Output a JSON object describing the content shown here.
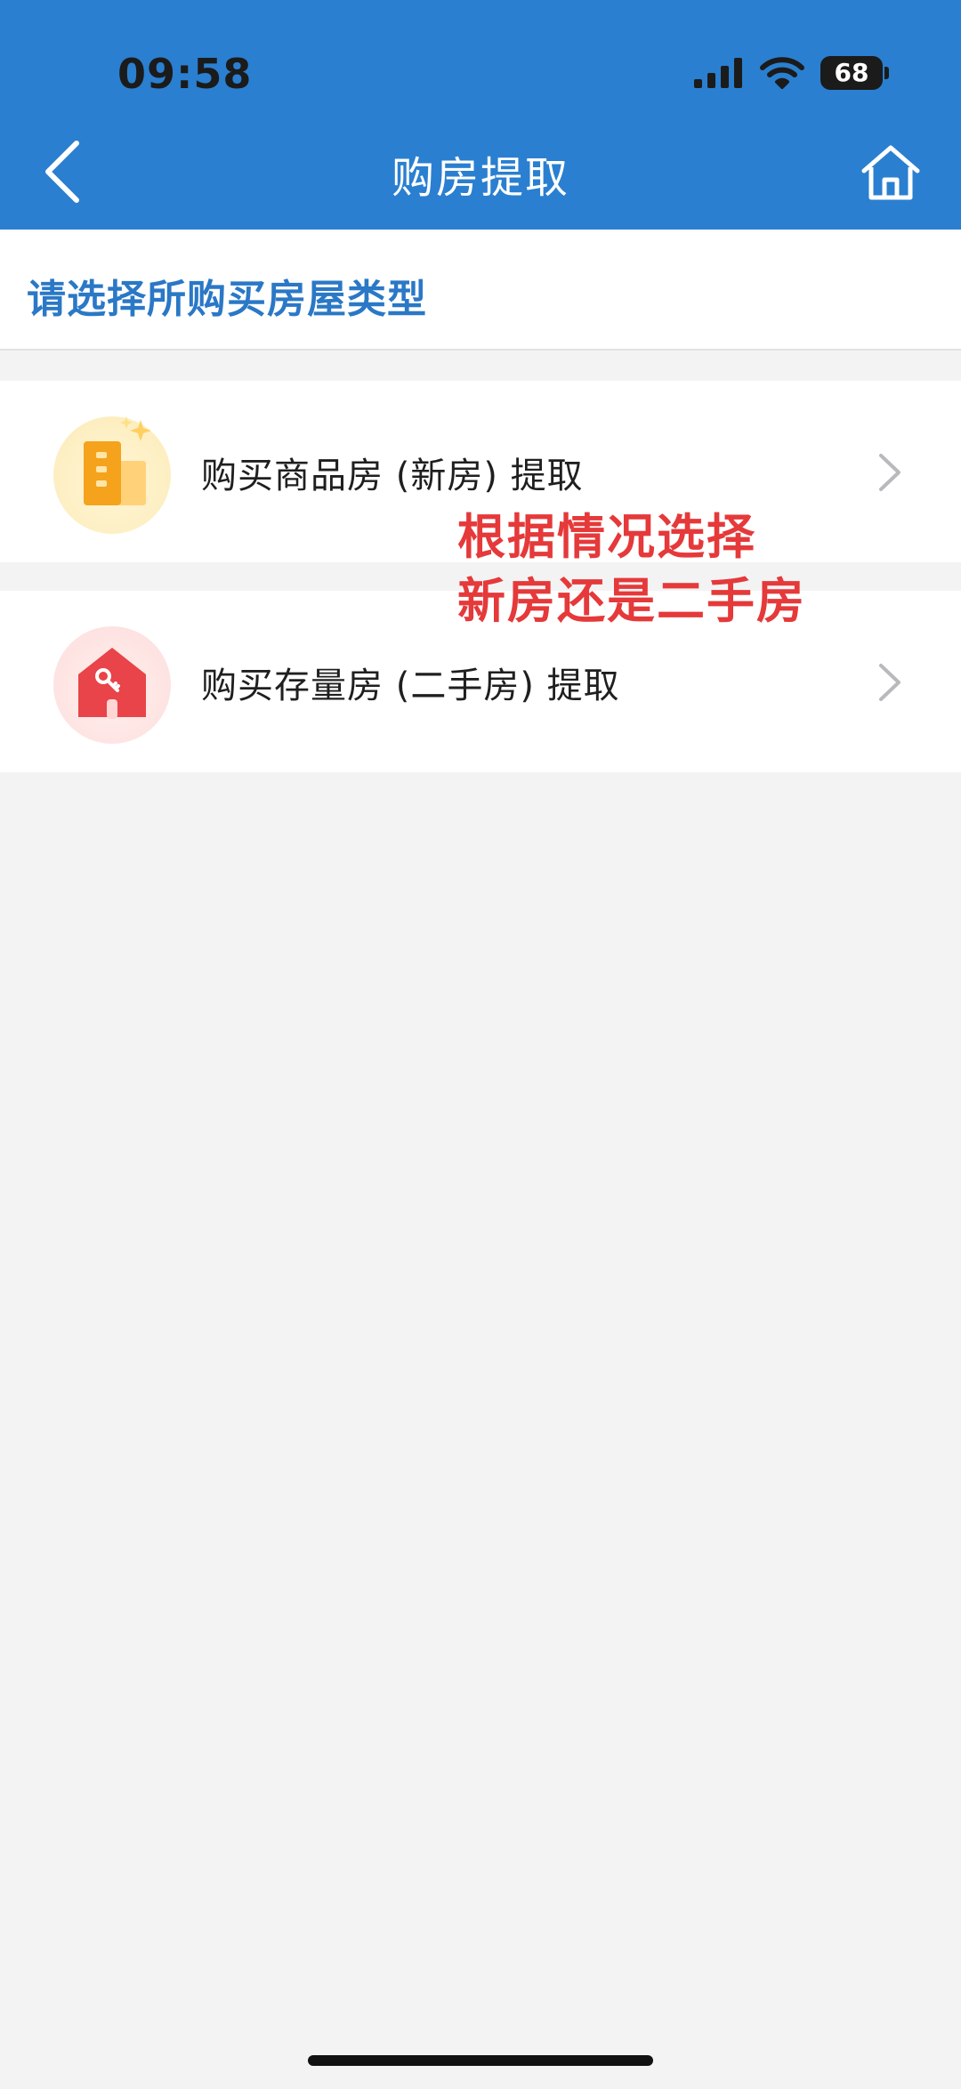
{
  "status_bar": {
    "time": "09:58",
    "battery": "68",
    "signal_icon": "cellular-signal-icon",
    "wifi_icon": "wifi-icon"
  },
  "nav": {
    "title": "购房提取",
    "back_icon": "chevron-left-icon",
    "home_icon": "home-icon"
  },
  "prompt": "请选择所购买房屋类型",
  "options": [
    {
      "label": "购买商品房 (新房) 提取",
      "icon": "building-icon",
      "accent": "#f5a21c"
    },
    {
      "label": "购买存量房 (二手房) 提取",
      "icon": "house-key-icon",
      "accent": "#e84449"
    }
  ],
  "annotation": {
    "line1": "根据情况选择",
    "line2": "新房还是二手房",
    "color": "#e5393a"
  },
  "colors": {
    "header": "#2a7fd0",
    "prompt_text": "#2a78c6",
    "background": "#f3f3f4"
  }
}
